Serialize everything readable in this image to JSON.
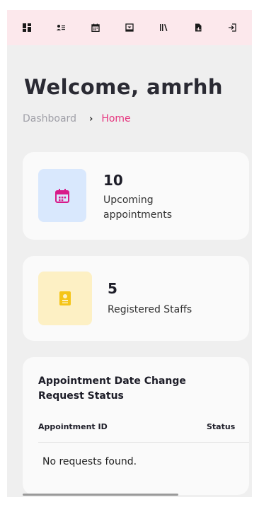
{
  "nav": {
    "items": [
      {
        "icon": "dashboard-icon"
      },
      {
        "icon": "staff-list-icon"
      },
      {
        "icon": "calendar-icon"
      },
      {
        "icon": "inbox-icon"
      },
      {
        "icon": "library-icon"
      },
      {
        "icon": "report-icon"
      },
      {
        "icon": "logout-icon"
      }
    ],
    "background": "#fce8ec"
  },
  "header": {
    "welcome": "Welcome, amrhh",
    "breadcrumb": {
      "parent": "Dashboard",
      "separator": "›",
      "current": "Home"
    }
  },
  "stats": {
    "appointments": {
      "count": "10",
      "label": "Upcoming appointments",
      "icon": "calendar-icon",
      "accent": "#d81b8a"
    },
    "staffs": {
      "count": "5",
      "label": "Registered Staffs",
      "icon": "id-badge-icon",
      "accent": "#f5c518"
    }
  },
  "requests": {
    "title": "Appointment Date Change Request Status",
    "columns": {
      "id": "Appointment ID",
      "status": "Status"
    },
    "empty_message": "No requests found."
  },
  "colors": {
    "accent": "#e6347e",
    "page_bg": "#efefef",
    "card_bg": "#fafafa"
  }
}
